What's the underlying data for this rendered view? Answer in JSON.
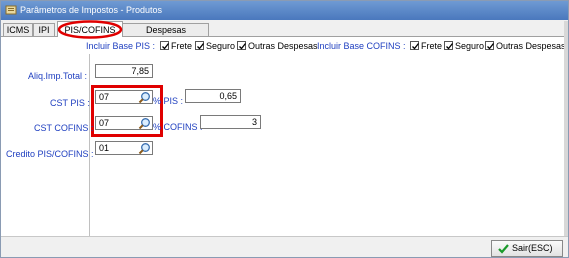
{
  "window": {
    "title": "Parâmetros de Impostos - Produtos"
  },
  "tabs": [
    {
      "label": "ICMS"
    },
    {
      "label": "IPI"
    },
    {
      "label": "PIS/COFINS"
    },
    {
      "label": "Despesas Acessórias"
    }
  ],
  "base_pis": {
    "label": "Incluir Base PIS :",
    "options": [
      {
        "label": "Frete",
        "checked": true
      },
      {
        "label": "Seguro",
        "checked": true
      },
      {
        "label": "Outras Despesas",
        "checked": true
      }
    ]
  },
  "base_cofins": {
    "label": "Incluir Base COFINS :",
    "options": [
      {
        "label": "Frete",
        "checked": true
      },
      {
        "label": "Seguro",
        "checked": true
      },
      {
        "label": "Outras Despesas",
        "checked": true
      }
    ]
  },
  "fields": {
    "aliq_label": "Aliq.Imp.Total :",
    "aliq_value": "7,85",
    "cst_pis_label": "CST PIS :",
    "cst_pis_value": "07",
    "pct_pis_label": "% PIS :",
    "pct_pis_value": "0,65",
    "cst_cofins_label": "CST COFINS :",
    "cst_cofins_value": "07",
    "pct_cofins_label": "% COFINS :",
    "pct_cofins_value": "3",
    "credito_label": "Credito PIS/COFINS :",
    "credito_value": "01"
  },
  "footer": {
    "exit_label": "Sair(ESC)"
  },
  "colors": {
    "label_blue": "#2040c0",
    "highlight_red": "#e00000",
    "title_bar": "#4a78bd"
  },
  "icons": [
    "app-icon",
    "magnifier-icon",
    "check-icon"
  ]
}
